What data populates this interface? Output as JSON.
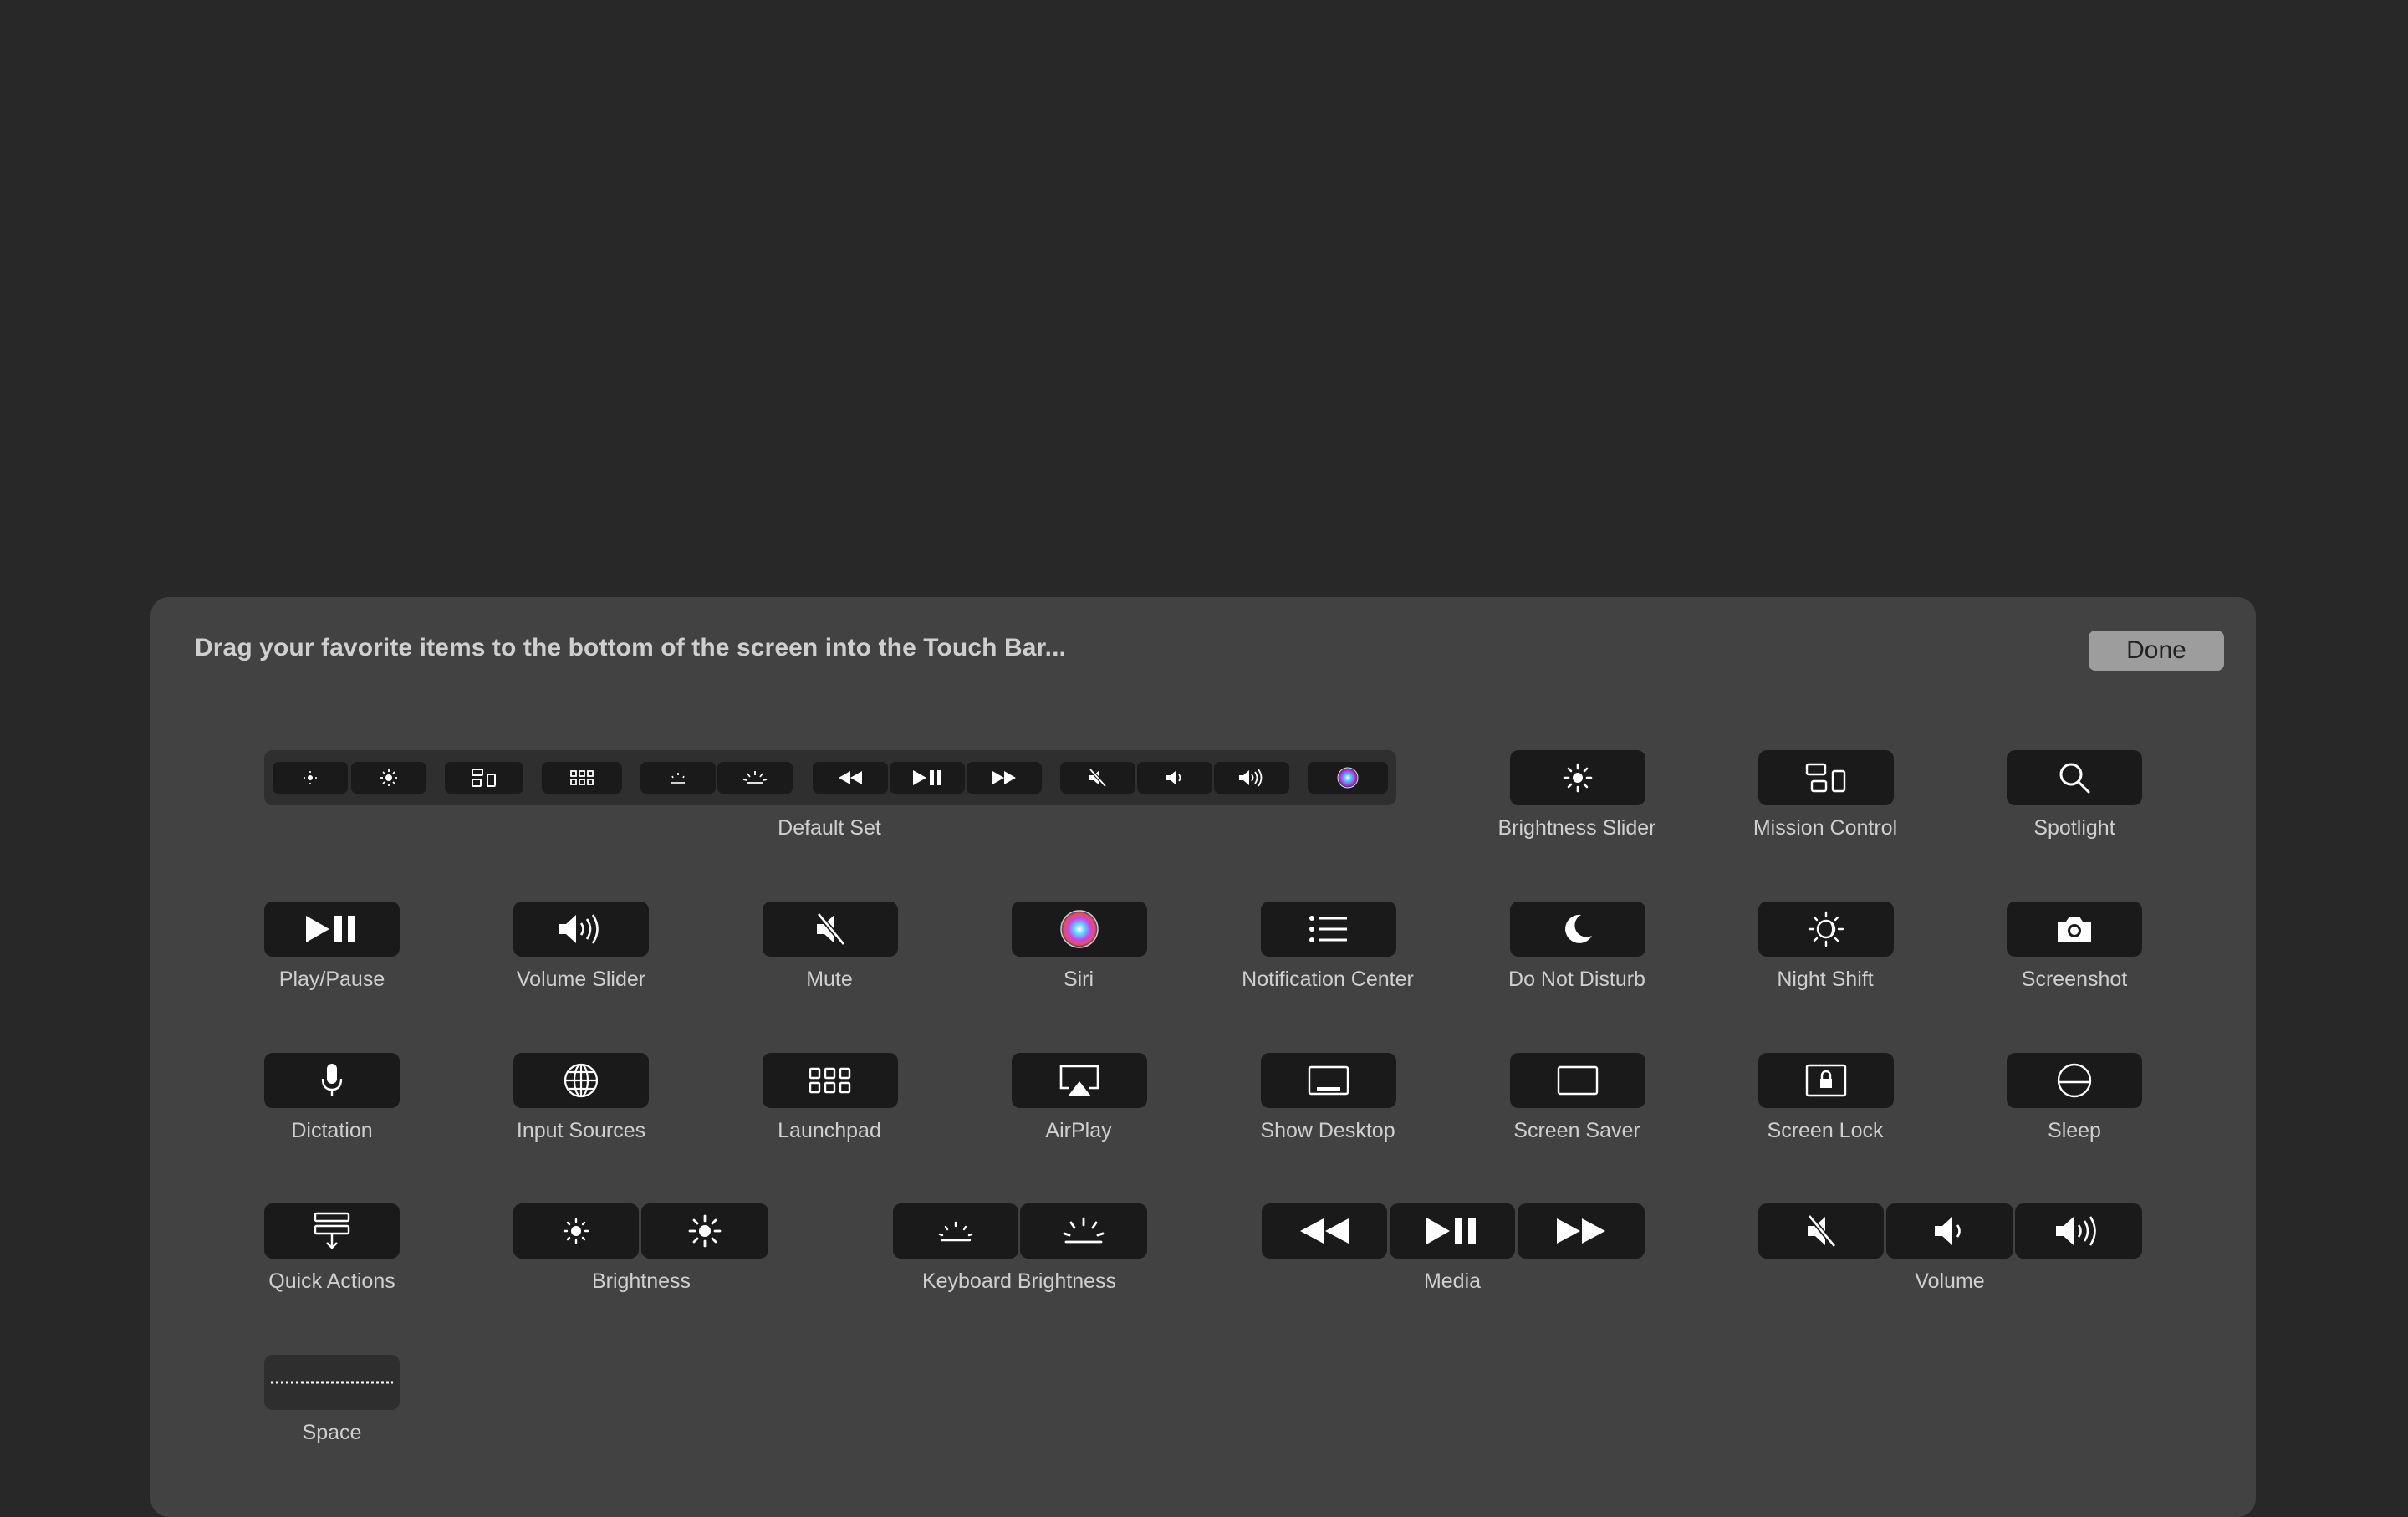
{
  "instructions": "Drag your favorite items to the bottom of the screen into the Touch Bar...",
  "done_label": "Done",
  "default_set": {
    "label": "Default Set",
    "icons": [
      "brightness-down-icon",
      "brightness-up-icon",
      "mission-control-icon",
      "launchpad-icon",
      "keyboard-brightness-down-icon",
      "keyboard-brightness-up-icon",
      "rewind-icon",
      "play-pause-icon",
      "fast-forward-icon",
      "mute-icon",
      "volume-down-icon",
      "volume-up-icon",
      "siri-icon"
    ]
  },
  "items": {
    "brightness_slider": "Brightness Slider",
    "mission_control": "Mission Control",
    "spotlight": "Spotlight",
    "play_pause": "Play/Pause",
    "volume_slider": "Volume Slider",
    "mute": "Mute",
    "siri": "Siri",
    "notification_center": "Notification Center",
    "do_not_disturb": "Do Not Disturb",
    "night_shift": "Night Shift",
    "screenshot": "Screenshot",
    "dictation": "Dictation",
    "input_sources": "Input Sources",
    "launchpad": "Launchpad",
    "airplay": "AirPlay",
    "show_desktop": "Show Desktop",
    "screen_saver": "Screen Saver",
    "screen_lock": "Screen Lock",
    "sleep": "Sleep",
    "quick_actions": "Quick Actions",
    "brightness": "Brightness",
    "keyboard_brightness": "Keyboard Brightness",
    "media": "Media",
    "volume": "Volume",
    "space": "Space"
  },
  "colors": {
    "background": "#282828",
    "panel": "#424242",
    "button": "#1a1a1a",
    "done_button": "#9d9d9d"
  }
}
